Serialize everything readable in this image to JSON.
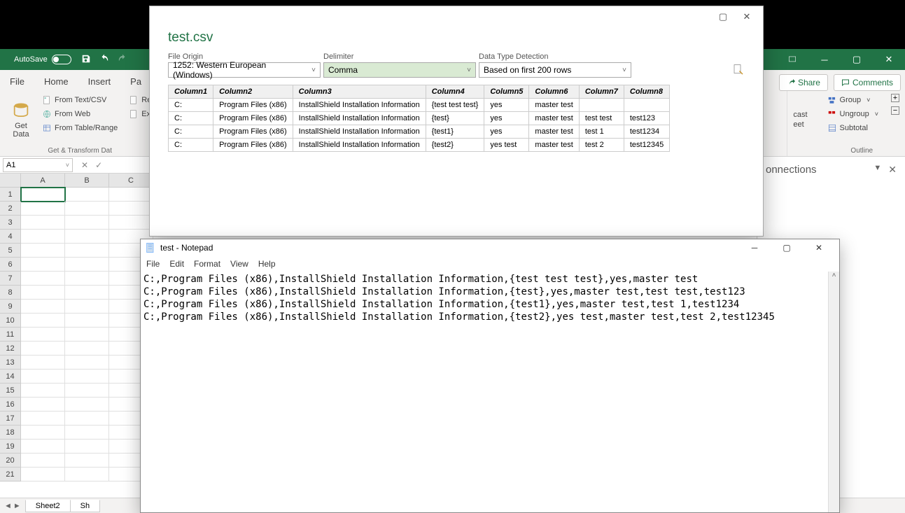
{
  "excel": {
    "autosave_label": "AutoSave",
    "tabs": [
      "File",
      "Home",
      "Insert",
      "Pa"
    ],
    "ribbon": {
      "get_data_label": "Get\nData",
      "from_textcsv": "From Text/CSV",
      "from_web": "From Web",
      "from_table": "From Table/Range",
      "recent_short": "Re",
      "existing_short": "Ex",
      "group_label_getdata": "Get & Transform Dat",
      "cast": "cast",
      "eet": "eet",
      "group": "Group",
      "ungroup": "Ungroup",
      "subtotal": "Subtotal",
      "outline": "Outline"
    },
    "share": "Share",
    "comments": "Comments",
    "namebox": "A1",
    "columns": [
      "A",
      "B",
      "C"
    ],
    "rows": 21,
    "sheet_tab": "Sheet2",
    "sheet_partial": "Sh",
    "qpane_title": "onnections"
  },
  "csv": {
    "filename": "test.csv",
    "file_origin_label": "File Origin",
    "file_origin_value": "1252: Western European (Windows)",
    "delimiter_label": "Delimiter",
    "delimiter_value": "Comma",
    "detection_label": "Data Type Detection",
    "detection_value": "Based on first 200 rows",
    "headers": [
      "Column1",
      "Column2",
      "Column3",
      "Column4",
      "Column5",
      "Column6",
      "Column7",
      "Column8"
    ],
    "rows": [
      [
        "C:",
        "Program Files (x86)",
        "InstallShield Installation Information",
        "{test test test}",
        "yes",
        "master test",
        "",
        ""
      ],
      [
        "C:",
        "Program Files (x86)",
        "InstallShield Installation Information",
        "{test}",
        "yes",
        "master test",
        "test test",
        "test123"
      ],
      [
        "C:",
        "Program Files (x86)",
        "InstallShield Installation Information",
        "{test1}",
        "yes",
        "master test",
        "test 1",
        "test1234"
      ],
      [
        "C:",
        "Program Files (x86)",
        "InstallShield Installation Information",
        "{test2}",
        "yes test",
        "master test",
        "test 2",
        "test12345"
      ]
    ]
  },
  "notepad": {
    "title": "test - Notepad",
    "menu": [
      "File",
      "Edit",
      "Format",
      "View",
      "Help"
    ],
    "content": "C:,Program Files (x86),InstallShield Installation Information,{test test test},yes,master test\nC:,Program Files (x86),InstallShield Installation Information,{test},yes,master test,test test,test123\nC:,Program Files (x86),InstallShield Installation Information,{test1},yes,master test,test 1,test1234\nC:,Program Files (x86),InstallShield Installation Information,{test2},yes test,master test,test 2,test12345"
  }
}
